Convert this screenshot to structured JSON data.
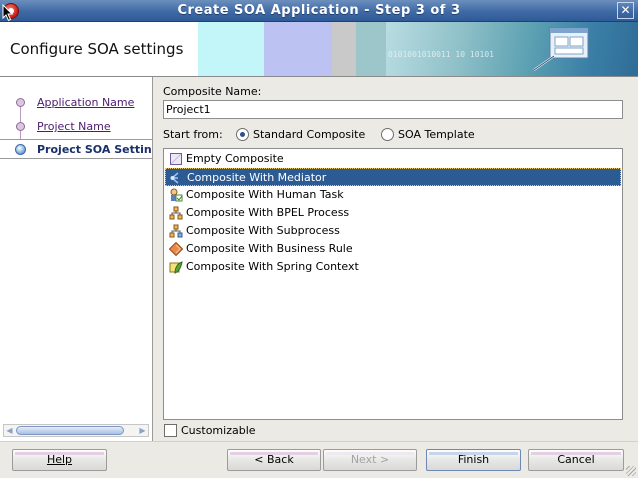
{
  "window": {
    "title": "Create SOA Application - Step 3 of 3",
    "close_glyph": "✕",
    "app_icon": "oracle-jdeveloper-icon"
  },
  "header": {
    "heading": "Configure SOA settings",
    "banner_digits": "0101001010011 10 10101"
  },
  "nav": {
    "items": [
      {
        "label": "Application Name",
        "state": "done"
      },
      {
        "label": "Project Name",
        "state": "done"
      },
      {
        "label": "Project SOA Settings",
        "state": "current"
      }
    ]
  },
  "form": {
    "composite_name_label": "Composite Name:",
    "composite_name_value": "Project1",
    "start_from_label": "Start from:",
    "radio_standard": "Standard Composite",
    "radio_template": "SOA Template",
    "selected_start": "Standard Composite"
  },
  "templates": {
    "items": [
      {
        "label": "Empty Composite",
        "icon": "empty-composite-icon"
      },
      {
        "label": "Composite With Mediator",
        "icon": "mediator-icon",
        "selected": true
      },
      {
        "label": "Composite With Human Task",
        "icon": "human-task-icon"
      },
      {
        "label": "Composite With BPEL Process",
        "icon": "bpel-process-icon"
      },
      {
        "label": "Composite With Subprocess",
        "icon": "subprocess-icon"
      },
      {
        "label": "Composite With Business Rule",
        "icon": "business-rule-icon"
      },
      {
        "label": "Composite With Spring Context",
        "icon": "spring-context-icon"
      }
    ]
  },
  "customizable": {
    "label": "Customizable",
    "checked": false
  },
  "buttons": {
    "help": "Help",
    "back": "< Back",
    "next": "Next >",
    "finish": "Finish",
    "cancel": "Cancel"
  }
}
